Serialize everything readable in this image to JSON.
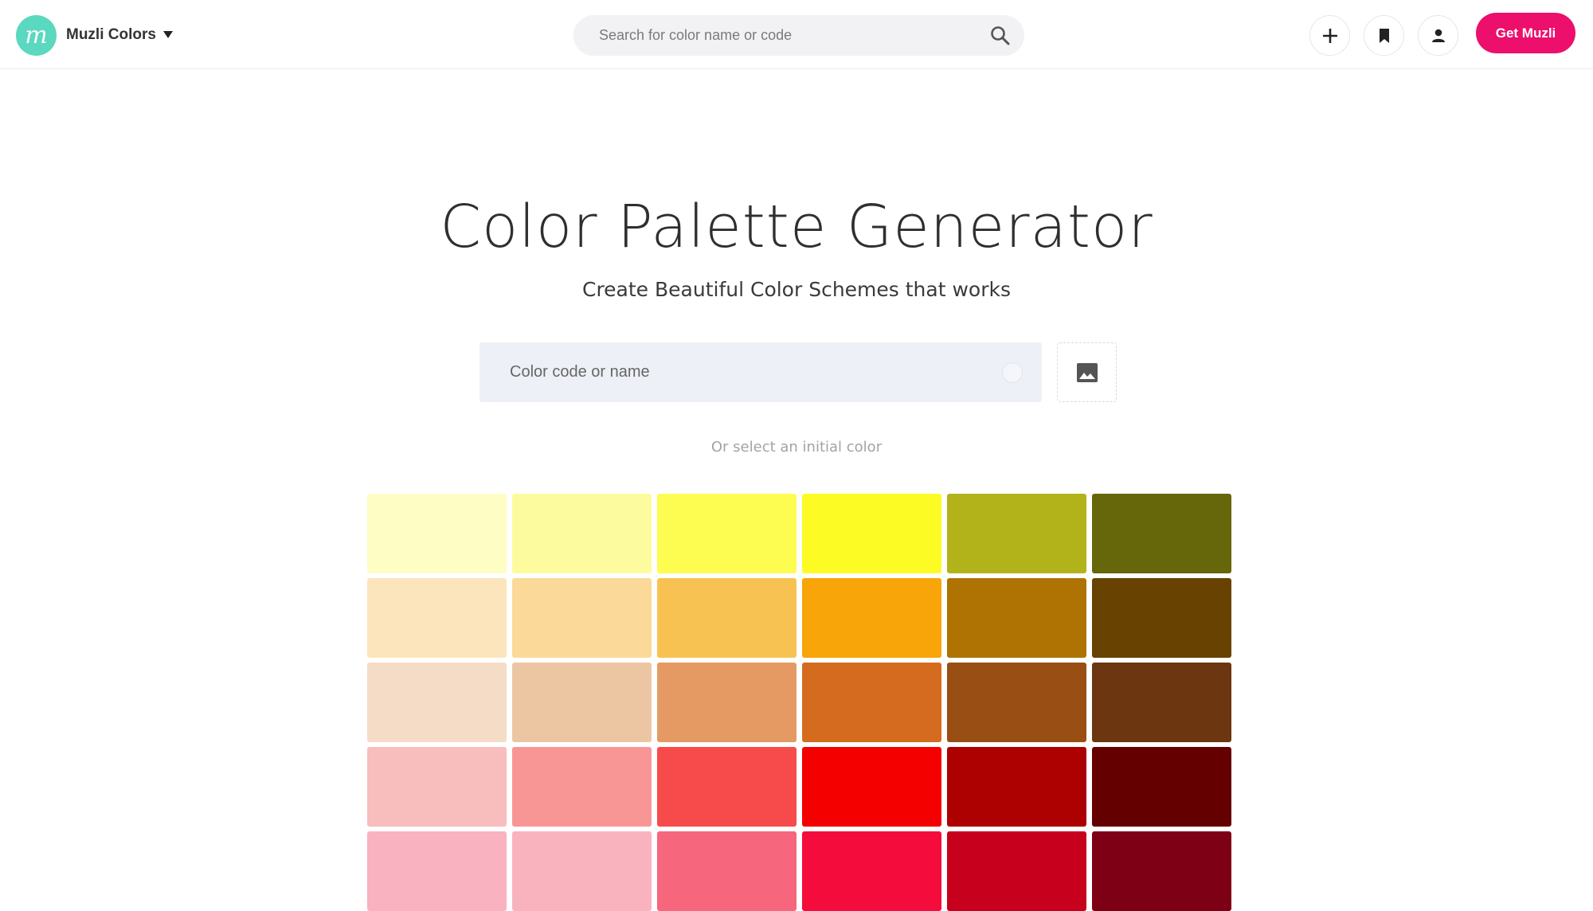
{
  "header": {
    "brand": "Muzli Colors",
    "logo_letter": "m",
    "search_placeholder": "Search for color name or code",
    "icons": {
      "brand_caret": "caret-down-icon",
      "search": "search-icon",
      "add": "plus-icon",
      "bookmark": "bookmark-icon",
      "user": "user-icon"
    },
    "cta_label": "Get Muzli",
    "cta_color": "#ec0f6c",
    "logo_color": "#5ad8c0"
  },
  "hero": {
    "title": "Color Palette Generator",
    "subtitle": "Create Beautiful Color Schemes that works"
  },
  "color_input": {
    "placeholder": "Color code or name",
    "image_upload_icon": "image-icon"
  },
  "initial_hint": "Or select an initial color",
  "swatches": [
    [
      "#fefec4",
      "#fcfc9e",
      "#fcfc51",
      "#fcfc24",
      "#b2b31b",
      "#66660a"
    ],
    [
      "#fce5bc",
      "#fbd998",
      "#f8c252",
      "#f7a508",
      "#ae7302",
      "#674200"
    ],
    [
      "#f5dcc6",
      "#ecc6a3",
      "#e49a62",
      "#d56b1f",
      "#994e14",
      "#6b3610"
    ],
    [
      "#f8bdbd",
      "#f89696",
      "#f74b4b",
      "#f50000",
      "#ad0000",
      "#650000"
    ],
    [
      "#f9b2bf",
      "#f9b3bf",
      "#f6667c",
      "#f40d3c",
      "#c7001d",
      "#7e0015"
    ]
  ]
}
